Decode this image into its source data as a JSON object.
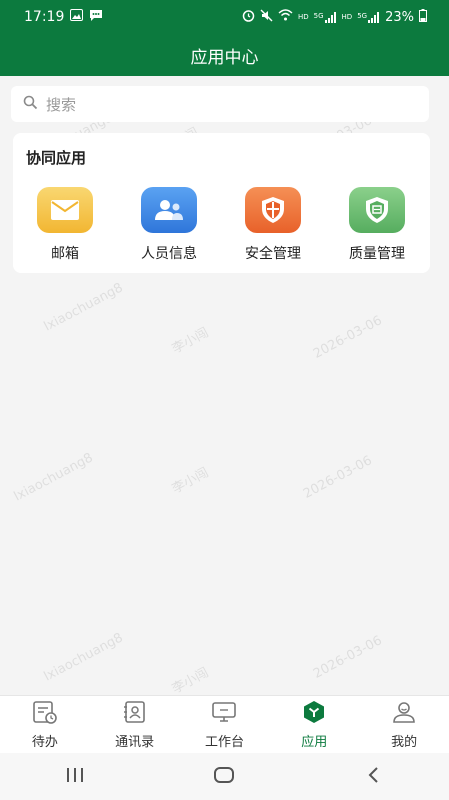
{
  "status": {
    "time": "17:19",
    "hd1": "HD",
    "sig1": "5G",
    "hd2": "HD",
    "sig2": "5G",
    "battery": "23%"
  },
  "header": {
    "title": "应用中心"
  },
  "search": {
    "placeholder": "搜索"
  },
  "section": {
    "title": "协同应用",
    "apps": [
      {
        "label": "邮箱",
        "icon": "mail-icon",
        "color": "#f5c64f"
      },
      {
        "label": "人员信息",
        "icon": "people-icon",
        "color": "#3f8ae8"
      },
      {
        "label": "安全管理",
        "icon": "shield-icon",
        "color": "#f07a3a"
      },
      {
        "label": "质量管理",
        "icon": "quality-shield-icon",
        "color": "#6dbd6d"
      }
    ]
  },
  "tabs": [
    {
      "label": "待办",
      "icon": "todo-icon"
    },
    {
      "label": "通讯录",
      "icon": "contacts-icon"
    },
    {
      "label": "工作台",
      "icon": "workbench-icon"
    },
    {
      "label": "应用",
      "icon": "apps-icon",
      "active": true
    },
    {
      "label": "我的",
      "icon": "profile-icon"
    }
  ],
  "watermark": {
    "user": "lxiaochuang8",
    "name": "李小闯",
    "date": "2026-03-06"
  },
  "colors": {
    "primary": "#0c7a3e"
  }
}
